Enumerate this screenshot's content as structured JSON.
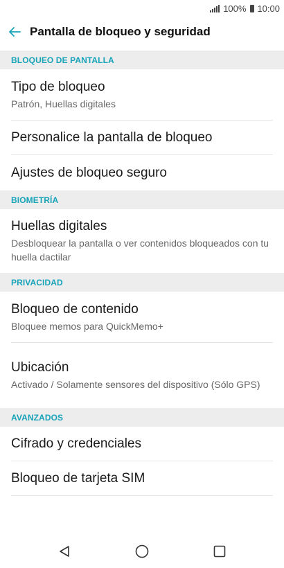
{
  "status_bar": {
    "battery": "100%",
    "time": "10:00"
  },
  "app_bar": {
    "title": "Pantalla de bloqueo y seguridad"
  },
  "sections": [
    {
      "header": "BLOQUEO DE PANTALLA",
      "items": [
        {
          "title": "Tipo de bloqueo",
          "subtitle": "Patrón, Huellas digitales"
        },
        {
          "title": "Personalice la pantalla de bloqueo"
        },
        {
          "title": "Ajustes de bloqueo seguro"
        }
      ]
    },
    {
      "header": "BIOMETRÍA",
      "items": [
        {
          "title": "Huellas digitales",
          "subtitle": "Desbloquear la pantalla o ver contenidos bloqueados con tu huella dactilar"
        }
      ]
    },
    {
      "header": "PRIVACIDAD",
      "items": [
        {
          "title": "Bloqueo de contenido",
          "subtitle": "Bloquee memos para QuickMemo+"
        },
        {
          "title": "Ubicación",
          "subtitle": "Activado / Solamente sensores del dispositivo (Sólo GPS)"
        }
      ]
    },
    {
      "header": "AVANZADOS",
      "items": [
        {
          "title": "Cifrado y credenciales"
        },
        {
          "title": "Bloqueo de tarjeta SIM"
        }
      ]
    }
  ],
  "colors": {
    "accent": "#17a3b8",
    "section_bg": "#ededed"
  },
  "icons": {
    "back": "arrow-left-icon",
    "nav_back": "triangle-back-icon",
    "nav_home": "circle-home-icon",
    "nav_recents": "square-recents-icon"
  }
}
